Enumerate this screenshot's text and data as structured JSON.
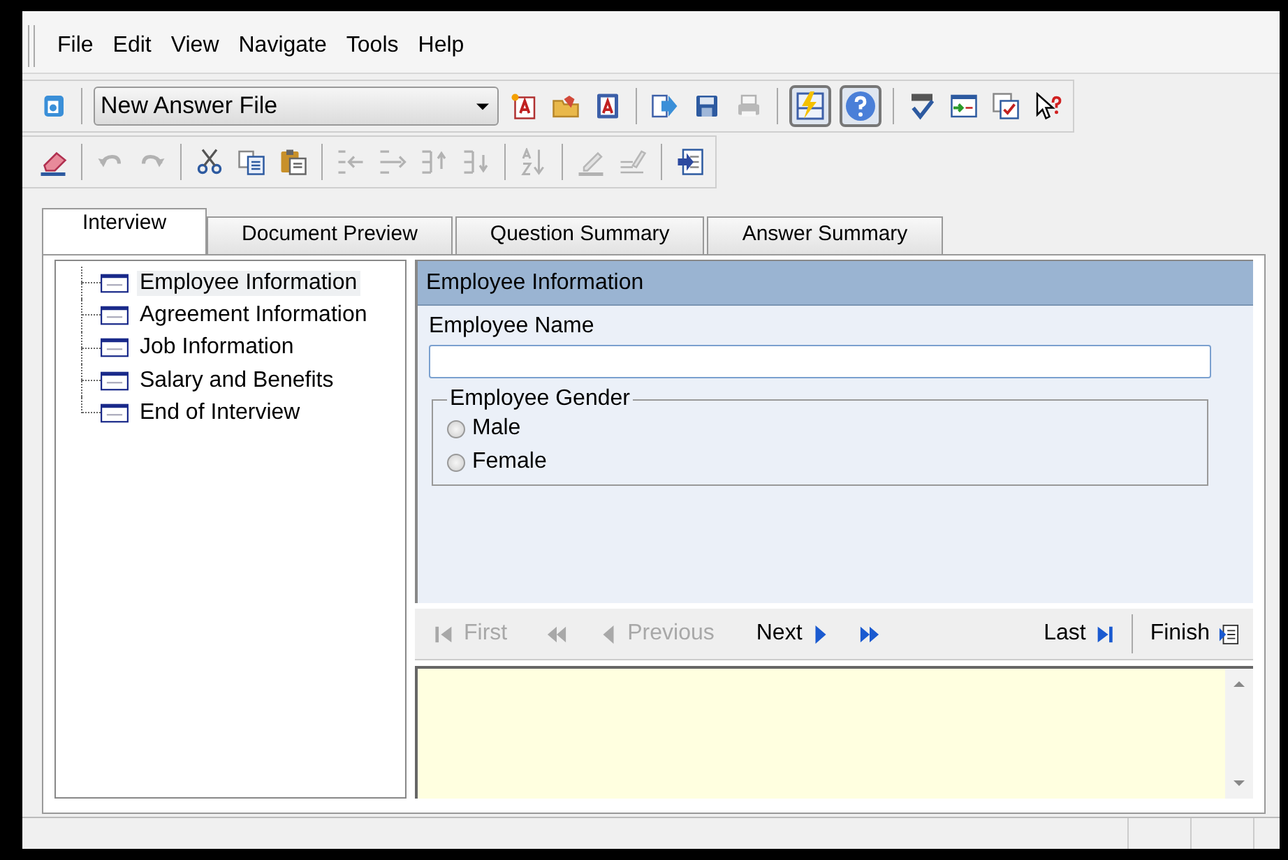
{
  "menu": [
    "File",
    "Edit",
    "View",
    "Navigate",
    "Tools",
    "Help"
  ],
  "toolbar_main": {
    "combo": {
      "value": "New Answer File"
    },
    "buttons": [
      {
        "kind": "new-answer",
        "disabled": false,
        "pressed": false
      },
      {
        "kind": "open",
        "disabled": false,
        "pressed": false
      },
      {
        "kind": "document",
        "disabled": false,
        "pressed": false
      },
      {
        "kind": "separator"
      },
      {
        "kind": "export",
        "disabled": false,
        "pressed": false
      },
      {
        "kind": "save",
        "disabled": false,
        "pressed": false
      },
      {
        "kind": "print",
        "disabled": true,
        "pressed": false
      },
      {
        "kind": "separator"
      },
      {
        "kind": "lightning",
        "disabled": false,
        "pressed": true
      },
      {
        "kind": "help",
        "disabled": false,
        "pressed": true
      },
      {
        "kind": "separator"
      },
      {
        "kind": "spellcheck",
        "disabled": false,
        "pressed": false
      },
      {
        "kind": "form",
        "disabled": false,
        "pressed": false
      },
      {
        "kind": "checklist",
        "disabled": false,
        "pressed": false
      },
      {
        "kind": "pointer-help",
        "disabled": false,
        "pressed": false
      }
    ]
  },
  "toolbar_edit": [
    {
      "kind": "eraser",
      "disabled": false
    },
    {
      "kind": "separator"
    },
    {
      "kind": "undo",
      "disabled": true
    },
    {
      "kind": "redo",
      "disabled": true
    },
    {
      "kind": "separator"
    },
    {
      "kind": "cut",
      "disabled": false
    },
    {
      "kind": "copy",
      "disabled": false
    },
    {
      "kind": "paste",
      "disabled": false
    },
    {
      "kind": "separator"
    },
    {
      "kind": "outdent",
      "disabled": true
    },
    {
      "kind": "indent",
      "disabled": true
    },
    {
      "kind": "move-up",
      "disabled": true
    },
    {
      "kind": "move-down",
      "disabled": true
    },
    {
      "kind": "separator"
    },
    {
      "kind": "sort",
      "disabled": true
    },
    {
      "kind": "separator"
    },
    {
      "kind": "pencil",
      "disabled": true
    },
    {
      "kind": "edit-lines",
      "disabled": true
    },
    {
      "kind": "separator"
    },
    {
      "kind": "import",
      "disabled": false
    }
  ],
  "tabs": [
    {
      "label": "Interview",
      "selected": true
    },
    {
      "label": "Document Preview",
      "selected": false
    },
    {
      "label": "Question Summary",
      "selected": false
    },
    {
      "label": "Answer Summary",
      "selected": false
    }
  ],
  "outline": [
    {
      "label": "Employee Information",
      "selected": true
    },
    {
      "label": "Agreement Information",
      "selected": false
    },
    {
      "label": "Job Information",
      "selected": false
    },
    {
      "label": "Salary and Benefits",
      "selected": false
    },
    {
      "label": "End of Interview",
      "selected": false
    }
  ],
  "dialog": {
    "title": "Employee Information",
    "name_field": {
      "label": "Employee Name"
    },
    "gender": {
      "legend": "Employee Gender",
      "options": [
        {
          "label": "Male",
          "selected": false
        },
        {
          "label": "Female",
          "selected": false
        }
      ]
    }
  },
  "navigation": [
    {
      "kind": "first",
      "label": "First",
      "disabled": true
    },
    {
      "kind": "rewind",
      "disabled": true
    },
    {
      "kind": "previous",
      "label": "Previous",
      "disabled": true
    },
    {
      "kind": "next",
      "label": "Next",
      "disabled": false
    },
    {
      "kind": "forward",
      "disabled": false
    },
    {
      "kind": "last",
      "label": "Last",
      "disabled": false
    },
    {
      "kind": "finish",
      "label": "Finish",
      "disabled": false
    }
  ]
}
